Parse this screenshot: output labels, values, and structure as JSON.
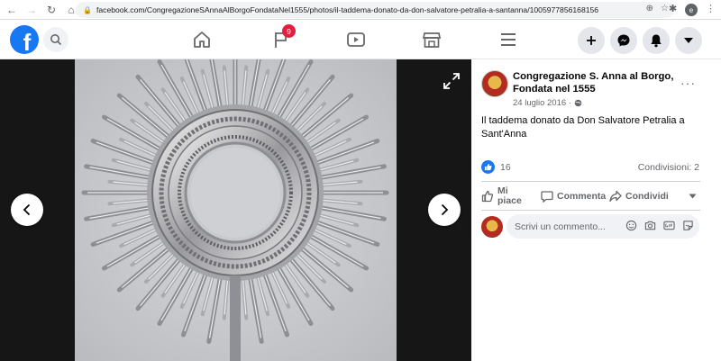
{
  "browser": {
    "url": "facebook.com/CongregazioneSAnnaAlBorgoFondataNel1555/photos/il-taddema-donato-da-don-salvatore-petralia-a-santanna/1005977856168156",
    "profile_initial": "e"
  },
  "fb_nav": {
    "flag_badge_count": "9",
    "logo_letter": "f"
  },
  "post": {
    "page_name": "Congregazione S. Anna al Borgo, Fondata nel 1555",
    "date": "24 luglio 2016 ·",
    "text": "Il taddema donato da Don Salvatore Petralia a Sant'Anna",
    "likes_count": "16",
    "shares": "Condivisioni: 2",
    "more": "···"
  },
  "actions": {
    "like": "Mi piace",
    "comment": "Commenta",
    "share": "Condividi"
  },
  "comment": {
    "placeholder": "Scrivi un commento..."
  },
  "colors": {
    "accent": "#1877f2",
    "badge": "#e41e3f"
  }
}
